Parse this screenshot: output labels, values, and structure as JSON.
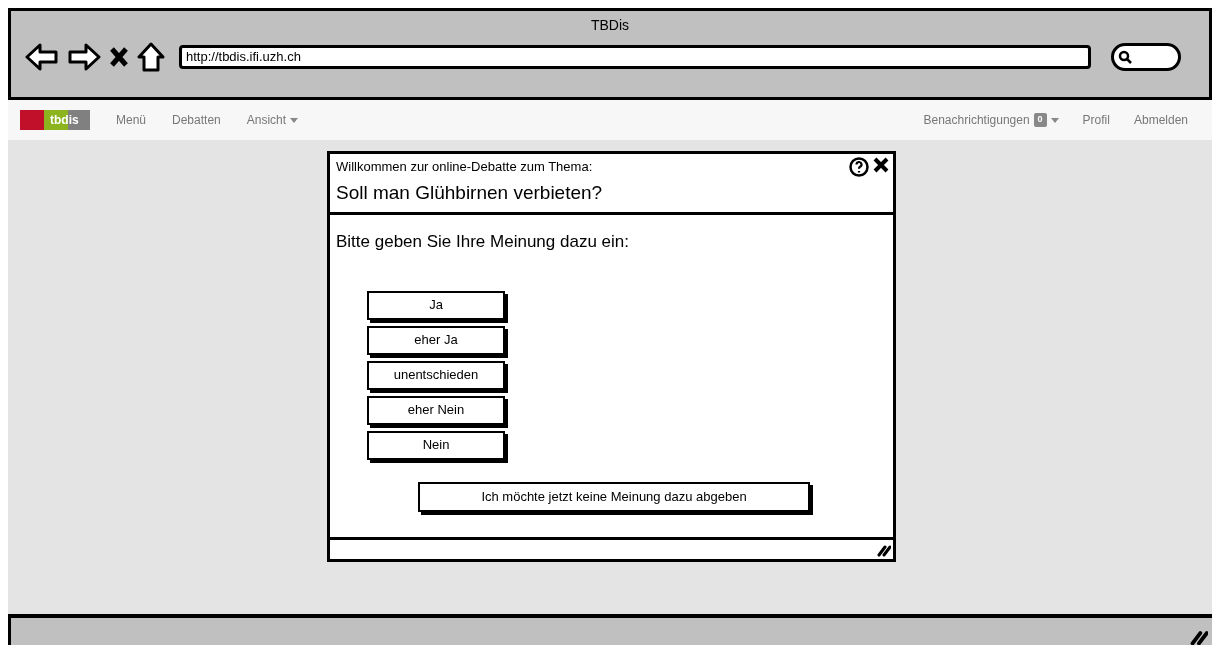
{
  "window": {
    "title": "TBDis"
  },
  "address_bar": {
    "value": "http://tbdis.ifi.uzh.ch"
  },
  "navbar": {
    "logo": "tbdis",
    "left_items": [
      {
        "label": "Menü",
        "dropdown": false
      },
      {
        "label": "Debatten",
        "dropdown": false
      },
      {
        "label": "Ansicht",
        "dropdown": true
      }
    ],
    "right_items": [
      {
        "label": "Benachrichtigungen",
        "badge": "0",
        "dropdown": true
      },
      {
        "label": "Profil",
        "dropdown": false
      },
      {
        "label": "Abmelden",
        "dropdown": false
      }
    ]
  },
  "dialog": {
    "subtitle": "Willkommen zur online-Debatte zum Thema:",
    "title": "Soll man Glühbirnen verbieten?",
    "prompt": "Bitte geben Sie Ihre Meinung dazu ein:",
    "options": [
      "Ja",
      "eher Ja",
      "unentschieden",
      "eher Nein",
      "Nein"
    ],
    "skip_button": "Ich möchte jetzt keine Meinung dazu abgeben"
  }
}
